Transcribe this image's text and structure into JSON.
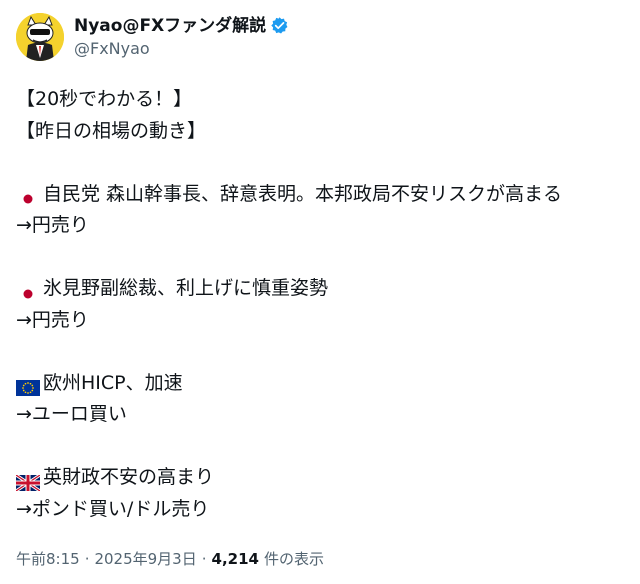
{
  "account": {
    "display_name": "Nyao@FXファンダ解説",
    "handle": "@FxNyao",
    "verified": true,
    "avatar_icon": "cat-avatar-icon"
  },
  "post": {
    "lines": [
      "【20秒でわかる！】",
      "【昨日の相場の動き】",
      "",
      "自民党 森山幹事長、辞意表明。本邦政局不安リスクが高まる",
      "→円売り",
      "",
      "氷見野副総裁、利上げに慎重姿勢",
      "→円売り",
      "",
      "欧州HICP、加速",
      "→ユーロ買い",
      "",
      "英財政不安の高まり",
      "→ポンド買い/ドル売り"
    ],
    "flags": {
      "jp_1": "japan-flag-icon",
      "jp_2": "japan-flag-icon",
      "eu": "eu-flag-icon",
      "uk": "uk-flag-icon"
    }
  },
  "meta": {
    "time": "午前8:15",
    "date": "2025年9月3日",
    "views_count": "4,214",
    "views_label": "件の表示"
  },
  "colors": {
    "text": "#0f1419",
    "secondary": "#536471",
    "verified": "#1d9bf0",
    "avatar_bg": "#f4d22d"
  }
}
